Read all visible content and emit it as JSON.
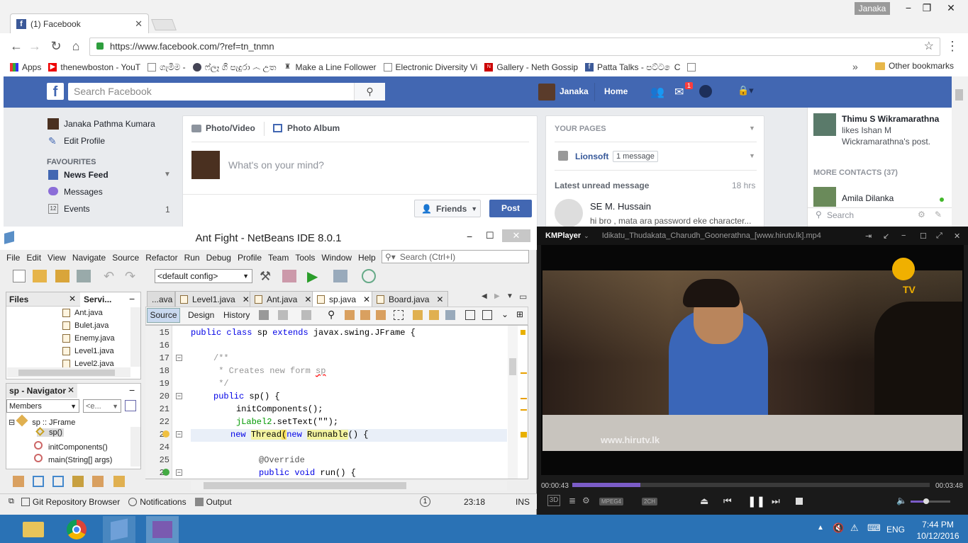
{
  "chrome": {
    "tab_title": "(1) Facebook",
    "user_badge": "Janaka",
    "url": "https://www.facebook.com/?ref=tn_tnmn",
    "bookmarks": [
      {
        "label": "Apps",
        "icon": "apps-grid-icon"
      },
      {
        "label": "thenewboston - YouT",
        "icon": "youtube-icon"
      },
      {
        "label": "ගැමිම -",
        "icon": "page-icon"
      },
      {
        "label": "ෆ්‍ලෑ ගී පැදුරා ෴ උත",
        "icon": "site-icon"
      },
      {
        "label": "Make a Line Follower",
        "icon": "robot-icon"
      },
      {
        "label": "Electronic Diversity Vi",
        "icon": "page-icon"
      },
      {
        "label": "Gallery - Neth Gossip",
        "icon": "gossip-icon"
      },
      {
        "label": "Patta Talks - පට්ට ෙC",
        "icon": "facebook-icon"
      },
      {
        "label": "",
        "icon": "page-icon"
      }
    ],
    "bookmarks_overflow": "»",
    "other_bookmarks": "Other bookmarks"
  },
  "facebook": {
    "search_placeholder": "Search Facebook",
    "user_name": "Janaka",
    "home": "Home",
    "notif_count": "1",
    "left": {
      "profile_name": "Janaka Pathma Kumara",
      "edit_profile": "Edit Profile",
      "favourites_heading": "FAVOURITES",
      "news_feed": "News Feed",
      "messages": "Messages",
      "events": "Events",
      "events_count": "1",
      "events_icon_day": "12"
    },
    "composer": {
      "photo_video": "Photo/Video",
      "photo_album": "Photo Album",
      "placeholder": "What's on your mind?",
      "audience": "Friends",
      "post": "Post"
    },
    "pages": {
      "heading": "YOUR PAGES",
      "page_name": "Lionsoft",
      "message_badge": "1 message",
      "latest_heading": "Latest unread message",
      "latest_time": "18 hrs",
      "sender": "SE M. Hussain",
      "preview": "hi bro , mata ara password eke character..."
    },
    "ticker": {
      "name": "Thimu S Wikramarathna",
      "action": "likes Ishan M Wickramarathna's post.",
      "more_contacts": "MORE CONTACTS (37)",
      "contact": "Amila Dilanka",
      "search_placeholder": "Search"
    }
  },
  "netbeans": {
    "title": "Ant Fight - NetBeans IDE 8.0.1",
    "menu": [
      "File",
      "Edit",
      "View",
      "Navigate",
      "Source",
      "Refactor",
      "Run",
      "Debug",
      "Profile",
      "Team",
      "Tools",
      "Window",
      "Help"
    ],
    "search_placeholder": "Search (Ctrl+I)",
    "config": "<default config>",
    "files_tab": "Files",
    "services_tab": "Servi...",
    "files": [
      "Ant.java",
      "Bulet.java",
      "Enemy.java",
      "Level1.java",
      "Level2.java"
    ],
    "navigator_tab": "sp - Navigator",
    "members_select": "Members",
    "empty_select": "<e...",
    "nav_items": [
      "sp :: JFrame",
      "sp()",
      "initComponents()",
      "main(String[] args)"
    ],
    "editor_tabs": [
      "...ava",
      "Level1.java",
      "Ant.java",
      "sp.java",
      "Board.java"
    ],
    "view_tabs": [
      "Source",
      "Design",
      "History"
    ],
    "line_numbers": [
      "15",
      "16",
      "17",
      "18",
      "19",
      "20",
      "21",
      "22",
      "23",
      "24",
      "25",
      "26"
    ],
    "code": {
      "l15_a": "public class ",
      "l15_b": "sp ",
      "l15_c": "extends ",
      "l15_d": "javax.swing.JFrame {",
      "l17": "/**",
      "l18_a": " * Creates new form ",
      "l18_b": "sp",
      "l19": " */",
      "l20_a": "public ",
      "l20_b": "sp() {",
      "l21": "initComponents();",
      "l22_a": "jLabel2",
      "l22_b": ".setText(\"\");",
      "l23_a": "new ",
      "l23_b": "Thread",
      "l23_c": "(",
      "l23_d": "new ",
      "l23_e": "Runnable",
      "l23_f": "() {",
      "l25": "@Override",
      "l26_a": "public void ",
      "l26_b": "run() {"
    },
    "status": {
      "git": "Git Repository Browser",
      "notifications": "Notifications",
      "output": "Output",
      "badge": "1",
      "position": "23:18",
      "mode": "INS"
    }
  },
  "kmplayer": {
    "app_name": "KMPlayer",
    "file_name": "Idikatu_Thudakata_Charudh_Goonerathna_[www.hirutv.lk].mp4",
    "watermark": "www.hirutv.lk",
    "logo_text": "TV",
    "time_elapsed": "00:00:43",
    "time_total": "00:03:48",
    "progress": 0.19,
    "volume": 0.4,
    "badge_mpeg": "MPEG4",
    "badge_ch": "2CH",
    "label_3d": "3D"
  },
  "taskbar": {
    "lang": "ENG",
    "time": "7:44 PM",
    "date": "10/12/2016"
  }
}
